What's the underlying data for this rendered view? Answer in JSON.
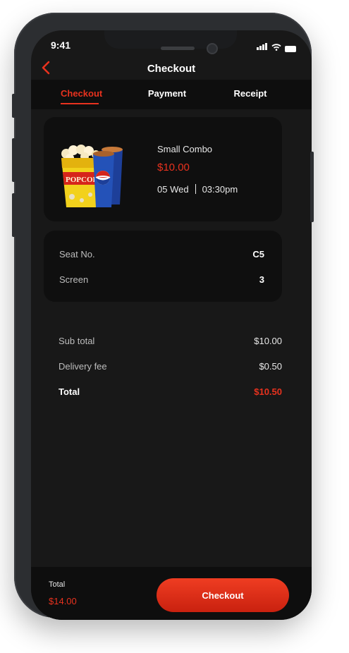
{
  "status": {
    "time": "9:41"
  },
  "header": {
    "title": "Checkout"
  },
  "tabs": [
    {
      "label": "Checkout",
      "active": true
    },
    {
      "label": "Payment",
      "active": false
    },
    {
      "label": "Receipt",
      "active": false
    }
  ],
  "item": {
    "image": "popcorn-pepsi-combo",
    "name": "Small Combo",
    "price": "$10.00",
    "date": "05 Wed",
    "time": "03:30pm"
  },
  "seat": {
    "seat_label": "Seat No.",
    "seat_value": "C5",
    "screen_label": "Screen",
    "screen_value": "3"
  },
  "summary": {
    "subtotal_label": "Sub total",
    "subtotal_value": "$10.00",
    "delivery_label": "Delivery fee",
    "delivery_value": "$0.50",
    "total_label": "Total",
    "total_value": "$10.50"
  },
  "footer": {
    "total_label": "Total",
    "total_value": "$14.00",
    "checkout_label": "Checkout"
  },
  "colors": {
    "accent": "#e8321e",
    "background": "#181818",
    "card": "#0f0f0f"
  }
}
